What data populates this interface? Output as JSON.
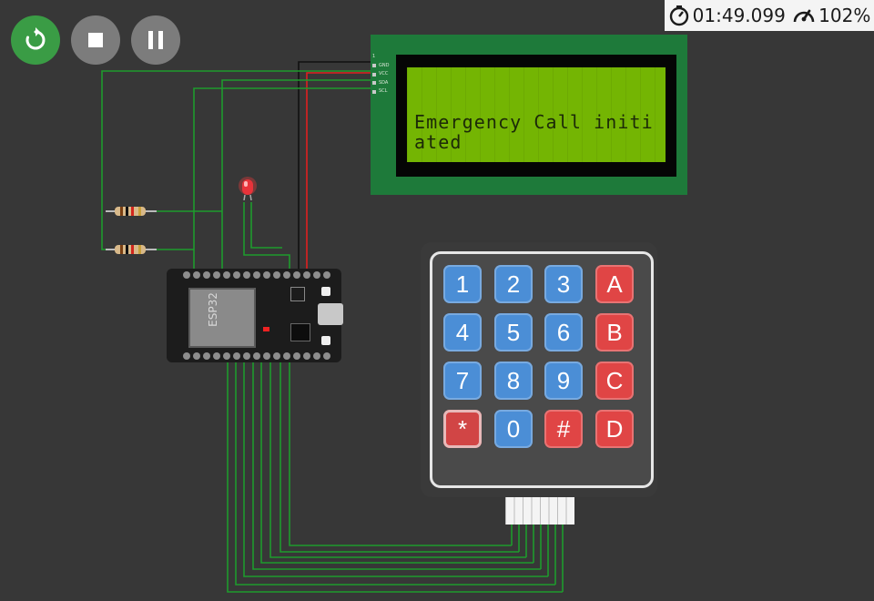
{
  "controls": {
    "restart": "restart-icon",
    "stop": "stop-icon",
    "pause": "pause-icon"
  },
  "status": {
    "timer": "01:49.099",
    "speed": "102%"
  },
  "lcd": {
    "line1": "Emergency Call initi",
    "line2": "ated",
    "pins": [
      "1",
      "GND",
      "VCC",
      "SDA",
      "SCL"
    ]
  },
  "esp32": {
    "label": "ESP32"
  },
  "keypad": {
    "keys": [
      "1",
      "2",
      "3",
      "A",
      "4",
      "5",
      "6",
      "B",
      "7",
      "8",
      "9",
      "C",
      "*",
      "0",
      "#",
      "D"
    ]
  },
  "colors": {
    "background": "#373737",
    "wire_green": "#1e9b2d",
    "wire_red": "#e02020",
    "wire_black": "#111111",
    "lcd_screen": "#74b503",
    "lcd_board": "#1e7a3a",
    "key_blue": "#4b8ed6",
    "key_red": "#e04545",
    "restart_green": "#3a9c45"
  }
}
